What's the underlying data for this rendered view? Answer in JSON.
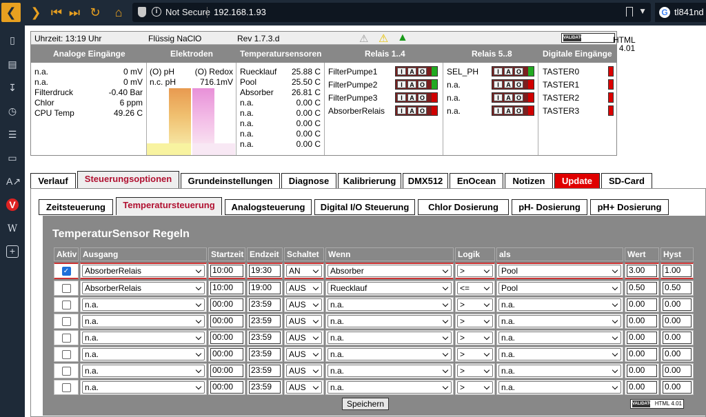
{
  "browser": {
    "security": "Not Secure",
    "url": "192.168.1.93",
    "search_tab": "tl841nd"
  },
  "status": {
    "time": "Uhrzeit: 13:19 Uhr",
    "chem": "Flüssig NaClO",
    "rev": "Rev 1.7.3.d",
    "validator": "HTML 4.01",
    "validator_logo": "VALIDATOR",
    "headers": [
      "Analoge Eingänge",
      "Elektroden",
      "Temperatursensoren",
      "Relais 1..4",
      "Relais 5..8",
      "Digitale Eingänge"
    ],
    "analog": [
      {
        "name": "n.a.",
        "value": "0 mV"
      },
      {
        "name": "n.a.",
        "value": "0 mV"
      },
      {
        "name": "Filterdruck",
        "value": "-0.40 Bar"
      },
      {
        "name": "Chlor",
        "value": "6 ppm"
      },
      {
        "name": "CPU Temp",
        "value": "49.26 C"
      }
    ],
    "electrodes": {
      "ph_label": "(O) pH",
      "redox_label": "(O) Redox",
      "ph_value": "n.c. pH",
      "redox_value": "716.1mV"
    },
    "temps": [
      {
        "name": "Ruecklauf",
        "value": "25.88 C"
      },
      {
        "name": "Pool",
        "value": "25.50 C"
      },
      {
        "name": "Absorber",
        "value": "26.81 C"
      },
      {
        "name": "n.a.",
        "value": "0.00 C"
      },
      {
        "name": "n.a.",
        "value": "0.00 C"
      },
      {
        "name": "n.a.",
        "value": "0.00 C"
      },
      {
        "name": "n.a.",
        "value": "0.00 C"
      },
      {
        "name": "n.a.",
        "value": "0.00 C"
      }
    ],
    "relais1": [
      {
        "name": "FilterPumpe1",
        "state": "on"
      },
      {
        "name": "FilterPumpe2",
        "state": "on"
      },
      {
        "name": "FilterPumpe3",
        "state": "off"
      },
      {
        "name": "AbsorberRelais",
        "state": "off"
      }
    ],
    "relais2": [
      {
        "name": "SEL_PH",
        "state": "on"
      },
      {
        "name": "n.a.",
        "state": "off"
      },
      {
        "name": "n.a.",
        "state": "off"
      },
      {
        "name": "n.a.",
        "state": "off"
      }
    ],
    "relay_letters": [
      "I",
      "A",
      "O"
    ],
    "digital": [
      "TASTER0",
      "TASTER1",
      "TASTER2",
      "TASTER3"
    ]
  },
  "tabs": [
    "Verlauf",
    "Steuerungsoptionen",
    "Grundeinstellungen",
    "Diagnose",
    "Kalibrierung",
    "DMX512",
    "EnOcean",
    "Notizen",
    "Update",
    "SD-Card"
  ],
  "subtabs": [
    "Zeitsteuerung",
    "Temperatursteuerung",
    "Analogsteuerung",
    "Digital I/O Steuerung",
    "Chlor Dosierung",
    "pH- Dosierung",
    "pH+ Dosierung"
  ],
  "rules": {
    "title": "TemperaturSensor Regeln",
    "columns": [
      "Aktiv",
      "Ausgang",
      "Startzeit",
      "Endzeit",
      "Schaltet",
      "Wenn",
      "Logik",
      "als",
      "Wert",
      "Hyst"
    ],
    "rows": [
      {
        "aktiv": true,
        "ausgang": "AbsorberRelais",
        "start": "10:00",
        "end": "19:30",
        "schaltet": "AN",
        "wenn": "Absorber",
        "logik": ">",
        "als": "Pool",
        "wert": "3.00",
        "hyst": "1.00"
      },
      {
        "aktiv": false,
        "ausgang": "AbsorberRelais",
        "start": "10:00",
        "end": "19:00",
        "schaltet": "AUS",
        "wenn": "Ruecklauf",
        "logik": "<=",
        "als": "Pool",
        "wert": "0.50",
        "hyst": "0.50"
      },
      {
        "aktiv": false,
        "ausgang": "n.a.",
        "start": "00:00",
        "end": "23:59",
        "schaltet": "AUS",
        "wenn": "n.a.",
        "logik": ">",
        "als": "n.a.",
        "wert": "0.00",
        "hyst": "0.00"
      },
      {
        "aktiv": false,
        "ausgang": "n.a.",
        "start": "00:00",
        "end": "23:59",
        "schaltet": "AUS",
        "wenn": "n.a.",
        "logik": ">",
        "als": "n.a.",
        "wert": "0.00",
        "hyst": "0.00"
      },
      {
        "aktiv": false,
        "ausgang": "n.a.",
        "start": "00:00",
        "end": "23:59",
        "schaltet": "AUS",
        "wenn": "n.a.",
        "logik": ">",
        "als": "n.a.",
        "wert": "0.00",
        "hyst": "0.00"
      },
      {
        "aktiv": false,
        "ausgang": "n.a.",
        "start": "00:00",
        "end": "23:59",
        "schaltet": "AUS",
        "wenn": "n.a.",
        "logik": ">",
        "als": "n.a.",
        "wert": "0.00",
        "hyst": "0.00"
      },
      {
        "aktiv": false,
        "ausgang": "n.a.",
        "start": "00:00",
        "end": "23:59",
        "schaltet": "AUS",
        "wenn": "n.a.",
        "logik": ">",
        "als": "n.a.",
        "wert": "0.00",
        "hyst": "0.00"
      },
      {
        "aktiv": false,
        "ausgang": "n.a.",
        "start": "00:00",
        "end": "23:59",
        "schaltet": "AUS",
        "wenn": "n.a.",
        "logik": ">",
        "als": "n.a.",
        "wert": "0.00",
        "hyst": "0.00"
      }
    ],
    "save_label": "Speichern"
  },
  "colors": {
    "accent": "#e8a020",
    "tab_active": "#b01030",
    "update_tab": "#e00000",
    "relay_on": "#22aa22",
    "input_off": "#d00000"
  }
}
